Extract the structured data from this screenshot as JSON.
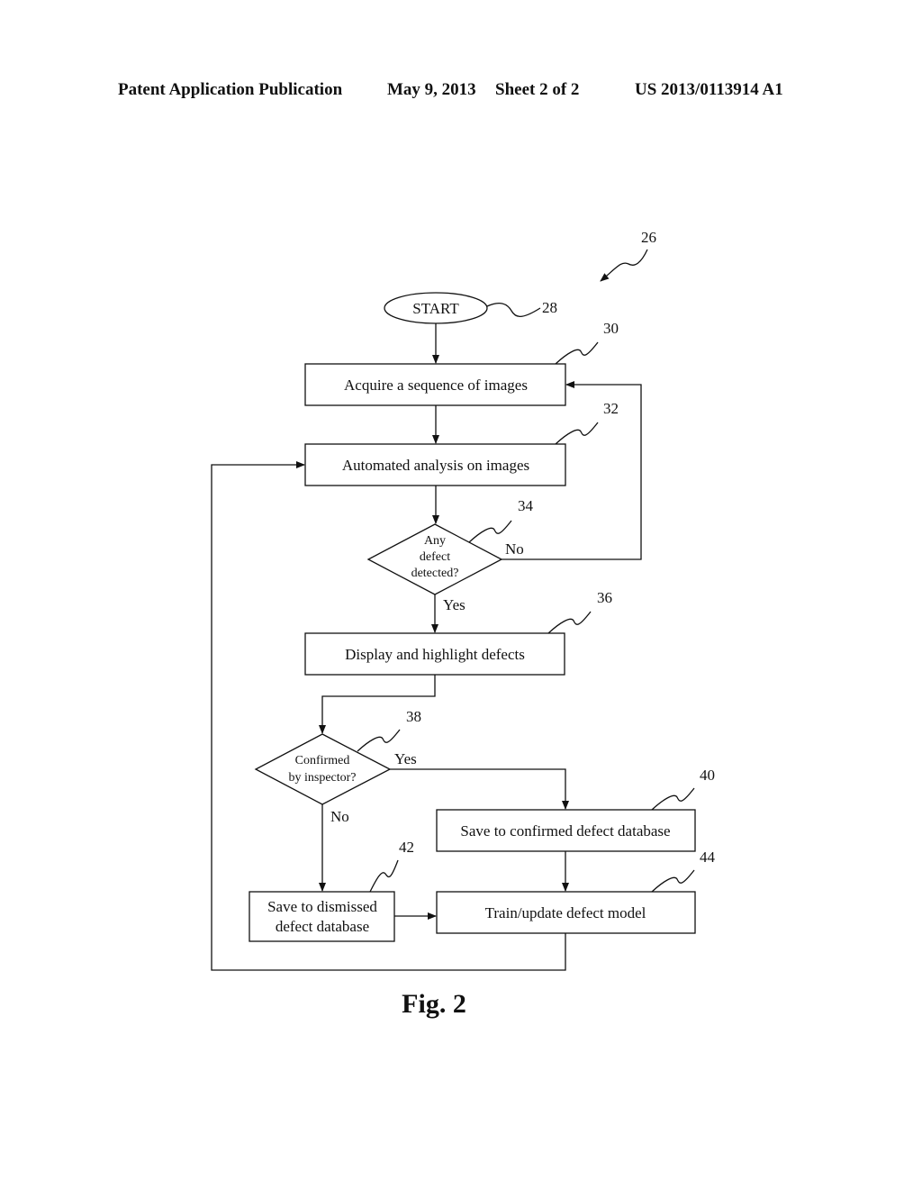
{
  "header": {
    "publication": "Patent Application Publication",
    "date": "May 9, 2013",
    "sheet": "Sheet 2 of 2",
    "number": "US 2013/0113914 A1"
  },
  "figure": {
    "caption": "Fig. 2",
    "ref": "26",
    "nodes": {
      "start": {
        "label": "START",
        "ref": "28"
      },
      "acquire": {
        "label": "Acquire a sequence of images",
        "ref": "30"
      },
      "analysis": {
        "label": "Automated analysis on images",
        "ref": "32"
      },
      "defect_q": {
        "lines": [
          "Any",
          "defect",
          "detected?"
        ],
        "ref": "34"
      },
      "display": {
        "label": "Display and highlight defects",
        "ref": "36"
      },
      "confirm_q": {
        "lines": [
          "Confirmed",
          "by inspector?"
        ],
        "ref": "38"
      },
      "save_confirmed": {
        "label": "Save to confirmed defect database",
        "ref": "40"
      },
      "save_dismissed": {
        "lines": [
          "Save to dismissed",
          "defect database"
        ],
        "ref": "42"
      },
      "train": {
        "label": "Train/update defect model",
        "ref": "44"
      }
    },
    "edge_labels": {
      "defect_no": "No",
      "defect_yes": "Yes",
      "confirm_yes": "Yes",
      "confirm_no": "No"
    }
  }
}
